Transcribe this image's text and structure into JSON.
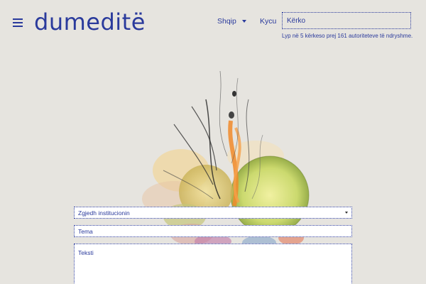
{
  "header": {
    "logo": "dumeditë",
    "language": "Shqip",
    "login": "Kycu",
    "search_placeholder": "Kërko",
    "stats_text": "Lyp në 5 kërkeso prej 161 autoriteteve të ndryshme."
  },
  "form": {
    "institution_select": "Zgjedh institucionin",
    "subject_placeholder": "Tema",
    "body_placeholder": "Teksti"
  },
  "colors": {
    "brand": "#2a3a9c",
    "background": "#e6e4df"
  },
  "icons": {
    "menu": "hamburger-menu-icon",
    "language_caret": "chevron-down-icon"
  }
}
